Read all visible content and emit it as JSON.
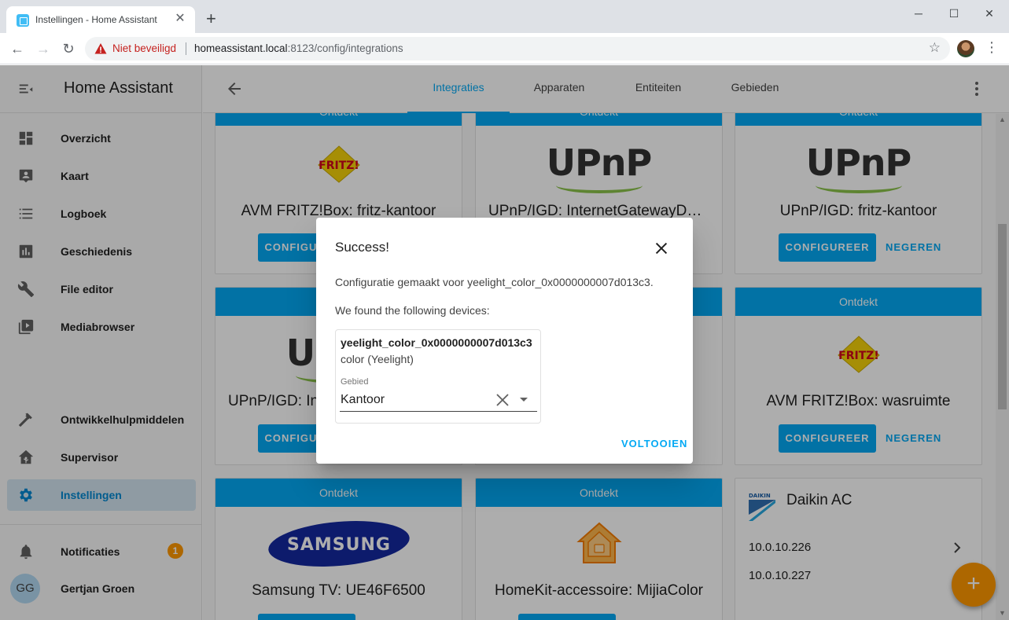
{
  "browser": {
    "tab_title": "Instellingen - Home Assistant",
    "tab_close": "✕",
    "new_tab": "+",
    "security_label": "Niet beveiligd",
    "url_host": "homeassistant.local",
    "url_rest": ":8123/config/integrations",
    "window_buttons": [
      "─",
      "☐",
      "✕"
    ]
  },
  "sidebar": {
    "title": "Home Assistant",
    "items": [
      {
        "label": "Overzicht",
        "icon": "dashboard-icon"
      },
      {
        "label": "Kaart",
        "icon": "map-account-icon"
      },
      {
        "label": "Logboek",
        "icon": "list-icon"
      },
      {
        "label": "Geschiedenis",
        "icon": "chart-box-icon"
      },
      {
        "label": "File editor",
        "icon": "wrench-icon"
      },
      {
        "label": "Mediabrowser",
        "icon": "play-box-multiple-icon"
      },
      {
        "label": "Ontwikkelhulpmiddelen",
        "icon": "hammer-icon"
      },
      {
        "label": "Supervisor",
        "icon": "home-assistant-icon"
      },
      {
        "label": "Instellingen",
        "icon": "cog-icon",
        "active": true
      }
    ],
    "notifications": {
      "label": "Notificaties",
      "count": "1"
    },
    "user": {
      "initials": "GG",
      "name": "Gertjan Groen"
    }
  },
  "toolbar": {
    "tabs": [
      "Integraties",
      "Apparaten",
      "Entiteiten",
      "Gebieden"
    ],
    "active_tab": "Integraties"
  },
  "cards": {
    "discovered_label": "Ontdekt",
    "configure_label": "CONFIGUREER",
    "ignore_label": "NEGEREN",
    "items": [
      {
        "name": "AVM FRITZ!Box: fritz-kantoor",
        "logo": "FRITZ!"
      },
      {
        "name": "UPnP/IGD: InternetGatewayDevice",
        "logo": "UPnP"
      },
      {
        "name": "UPnP/IGD: fritz-kantoor",
        "logo": "UPnP"
      },
      {
        "name": "UPnP/IGD: InternetGatewayDevice",
        "logo": "UPnP"
      },
      {
        "name": "AVM FRITZ!Box: wasruimte",
        "logo": "FRITZ!"
      },
      {
        "name": "Samsung TV: UE46F6500",
        "logo": "SAMSUNG"
      },
      {
        "name": "HomeKit-accessoire: MijiaColor",
        "logo": "homekit-icon"
      }
    ],
    "daikin": {
      "title": "Daikin AC",
      "logo": "DAIKIN",
      "entries": [
        "10.0.10.226",
        "10.0.10.227"
      ]
    }
  },
  "dialog": {
    "title": "Success!",
    "message": "Configuratie gemaakt voor yeelight_color_0x0000000007d013c3.",
    "found": "We found the following devices:",
    "device": {
      "name": "yeelight_color_0x0000000007d013c3",
      "model": "color (Yeelight)",
      "area_label": "Gebied",
      "area_value": "Kantoor"
    },
    "finish": "VOLTOOIEN"
  },
  "colors": {
    "primary": "#03a9f4",
    "accent": "#ff9800",
    "insecure": "#c5221f"
  }
}
